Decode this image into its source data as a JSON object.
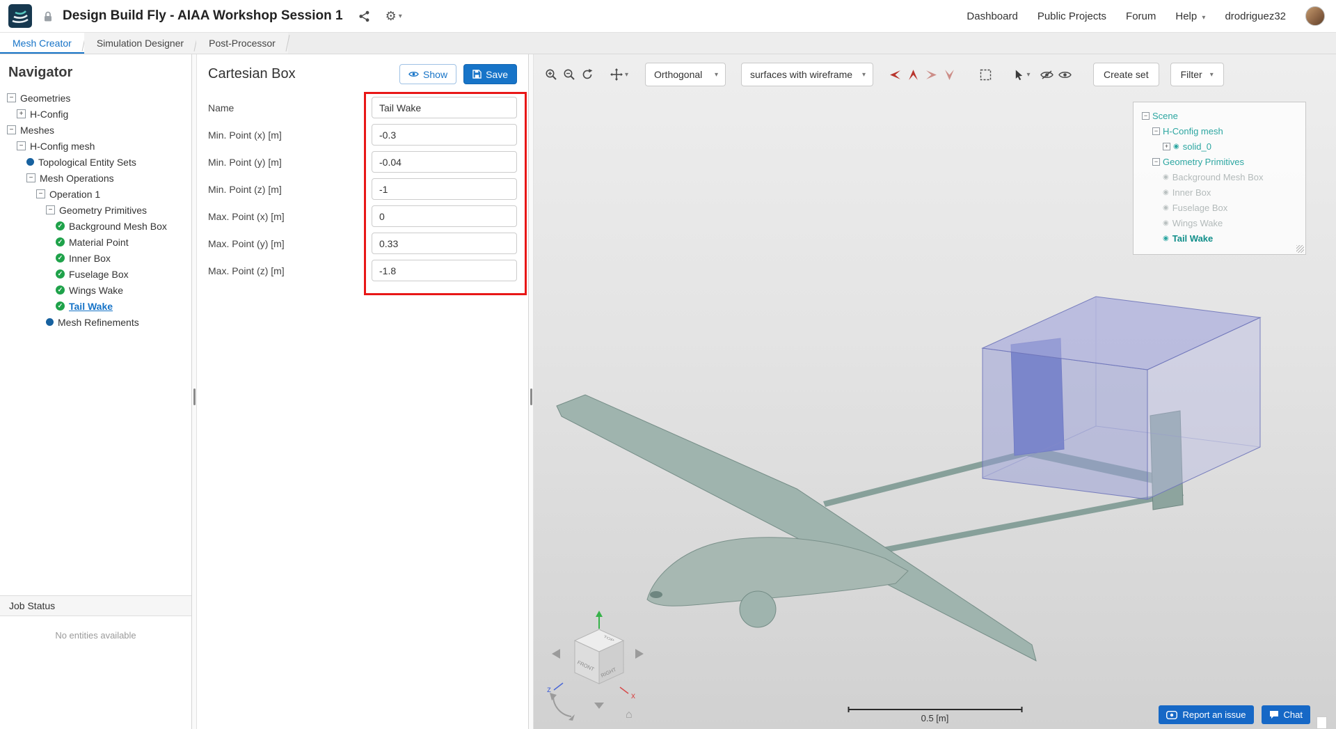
{
  "header": {
    "title": "Design Build Fly - AIAA Workshop Session 1",
    "nav": {
      "dashboard": "Dashboard",
      "public_projects": "Public Projects",
      "forum": "Forum",
      "help": "Help",
      "username": "drodriguez32"
    }
  },
  "tabs": [
    {
      "label": "Mesh Creator",
      "active": true
    },
    {
      "label": "Simulation Designer",
      "active": false
    },
    {
      "label": "Post-Processor",
      "active": false
    }
  ],
  "navigator": {
    "title": "Navigator",
    "tree": [
      {
        "label": "Geometries",
        "level": 0,
        "expander": "minus"
      },
      {
        "label": "H-Config",
        "level": 1,
        "expander": "plus"
      },
      {
        "label": "Meshes",
        "level": 0,
        "expander": "minus"
      },
      {
        "label": "H-Config mesh",
        "level": 1,
        "expander": "minus"
      },
      {
        "label": "Topological Entity Sets",
        "level": 2,
        "icon": "blue-dot"
      },
      {
        "label": "Mesh Operations",
        "level": 2,
        "expander": "minus"
      },
      {
        "label": "Operation 1",
        "level": 3,
        "expander": "minus"
      },
      {
        "label": "Geometry Primitives",
        "level": 4,
        "expander": "minus"
      },
      {
        "label": "Background Mesh Box",
        "level": 5,
        "icon": "check"
      },
      {
        "label": "Material Point",
        "level": 5,
        "icon": "check"
      },
      {
        "label": "Inner Box",
        "level": 5,
        "icon": "check"
      },
      {
        "label": "Fuselage Box",
        "level": 5,
        "icon": "check"
      },
      {
        "label": "Wings Wake",
        "level": 5,
        "icon": "check"
      },
      {
        "label": "Tail Wake",
        "level": 5,
        "icon": "check",
        "selected": true
      },
      {
        "label": "Mesh Refinements",
        "level": 4,
        "icon": "blue-dot"
      }
    ],
    "job_status": {
      "title": "Job Status",
      "empty_message": "No entities available"
    }
  },
  "panel": {
    "title": "Cartesian Box",
    "show_button": "Show",
    "save_button": "Save",
    "fields": [
      {
        "label": "Name",
        "value": "Tail Wake"
      },
      {
        "label": "Min. Point (x) [m]",
        "value": "-0.3"
      },
      {
        "label": "Min. Point (y) [m]",
        "value": "-0.04"
      },
      {
        "label": "Min. Point (z) [m]",
        "value": "-1"
      },
      {
        "label": "Max. Point (x) [m]",
        "value": "0"
      },
      {
        "label": "Max. Point (y) [m]",
        "value": "0.33"
      },
      {
        "label": "Max. Point (z) [m]",
        "value": "-1.8"
      }
    ]
  },
  "viewport": {
    "toolbar": {
      "projection": "Orthogonal",
      "render_mode": "surfaces with wireframe",
      "create_set": "Create set",
      "filter": "Filter"
    },
    "scene_tree": [
      {
        "label": "Scene",
        "level": 0,
        "expander": "minus"
      },
      {
        "label": "H-Config mesh",
        "level": 1,
        "expander": "minus"
      },
      {
        "label": "solid_0",
        "level": 2,
        "expander": "plus",
        "eye": true
      },
      {
        "label": "Geometry Primitives",
        "level": 1,
        "expander": "minus"
      },
      {
        "label": "Background Mesh Box",
        "level": 2,
        "eye": true,
        "dim": true
      },
      {
        "label": "Inner Box",
        "level": 2,
        "eye": true,
        "dim": true
      },
      {
        "label": "Fuselage Box",
        "level": 2,
        "eye": true,
        "dim": true
      },
      {
        "label": "Wings Wake",
        "level": 2,
        "eye": true,
        "dim": true
      },
      {
        "label": "Tail Wake",
        "level": 2,
        "eye": true,
        "selected": true
      }
    ],
    "scale_bar": "0.5 [m]",
    "cube": {
      "top": "TOP",
      "front": "FRONT",
      "right": "RIGHT",
      "axis_x": "x",
      "axis_z": "z"
    },
    "buttons": {
      "report_issue": "Report an issue",
      "chat": "Chat"
    }
  },
  "colors": {
    "accent_blue": "#1673c7",
    "highlight_red": "#e81717",
    "tree_teal": "#2ca6a1",
    "check_green": "#1fa24a",
    "box_purple": "#9499d4"
  }
}
